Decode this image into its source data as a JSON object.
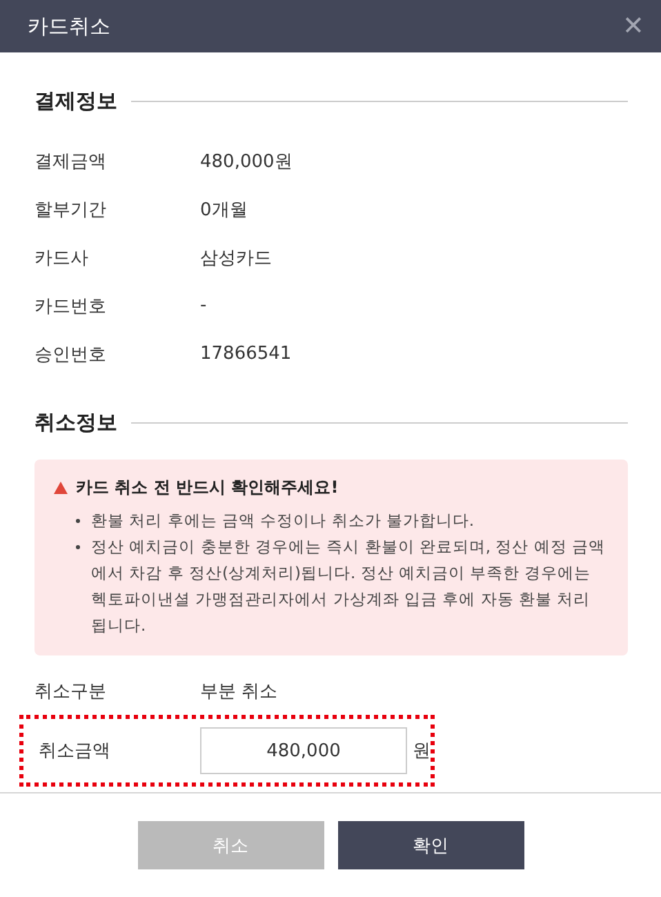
{
  "window": {
    "title": "카드취소",
    "close": "✕"
  },
  "payment_section": {
    "title": "결제정보",
    "rows": [
      {
        "label": "결제금액",
        "value": "480,000원"
      },
      {
        "label": "할부기간",
        "value": "0개월"
      },
      {
        "label": "카드사",
        "value": "삼성카드"
      },
      {
        "label": "카드번호",
        "value": "-"
      },
      {
        "label": "승인번호",
        "value": "17866541"
      }
    ]
  },
  "cancel_section": {
    "title": "취소정보",
    "notice": {
      "title": "카드 취소 전 반드시 확인해주세요!",
      "items": [
        "환불 처리 후에는 금액 수정이나 취소가 불가합니다.",
        "정산 예치금이 충분한 경우에는 즉시 환불이 완료되며, 정산 예정 금액에서 차감 후 정산(상계처리)됩니다. 정산 예치금이 부족한 경우에는 헥토파이낸셜 가맹점관리자에서 가상계좌 입금 후에 자동 환불 처리 됩니다."
      ]
    },
    "type": {
      "label": "취소구분",
      "value": "부분 취소"
    },
    "amount": {
      "label": "취소금액",
      "value": "480,000",
      "unit": "원",
      "highlighted": true
    }
  },
  "buttons": [
    {
      "label": "취소",
      "kind": "secondary"
    },
    {
      "label": "확인",
      "kind": "primary"
    }
  ]
}
